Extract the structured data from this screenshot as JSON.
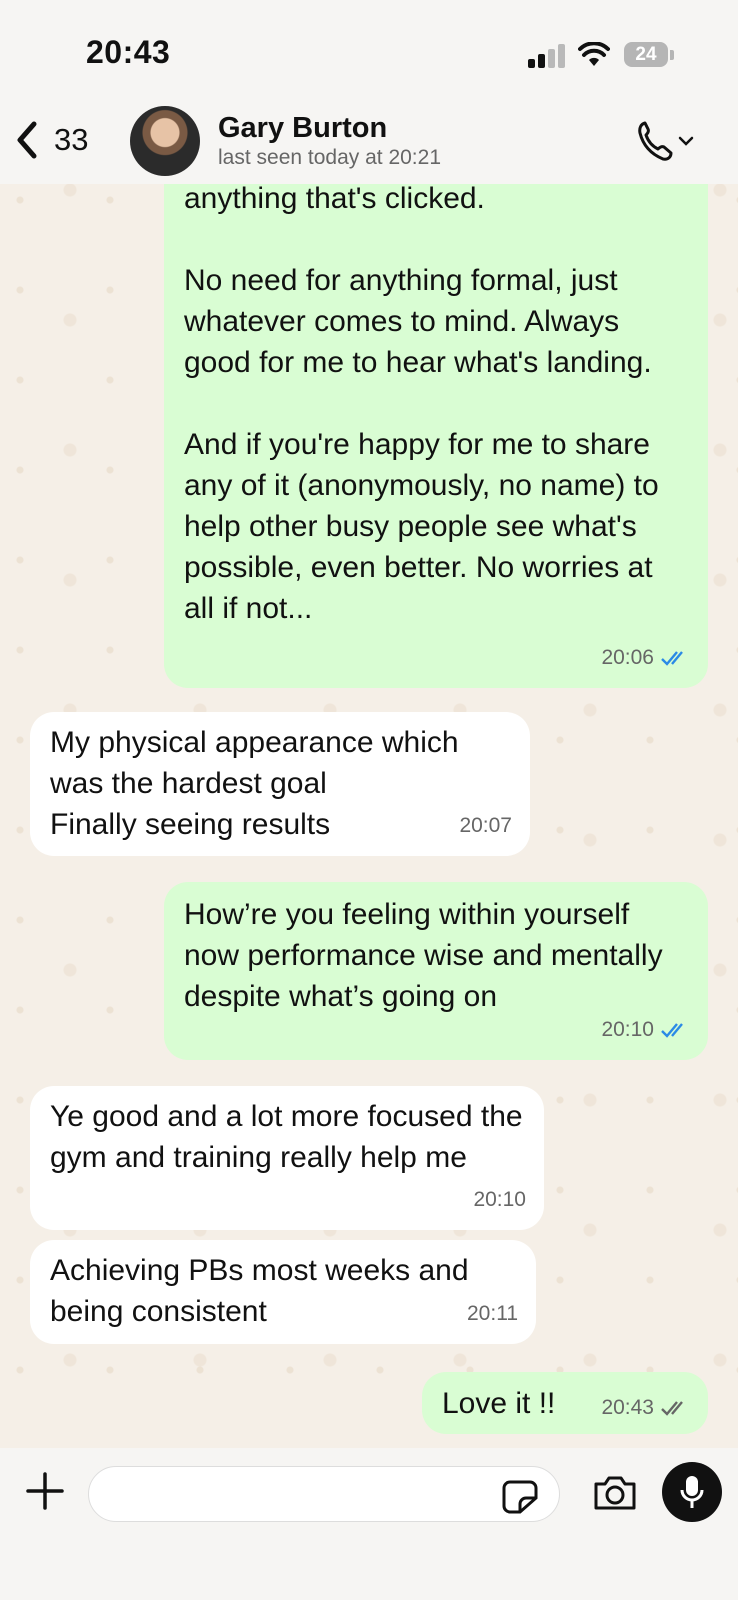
{
  "status_bar": {
    "time": "20:43",
    "battery": "24"
  },
  "header": {
    "back_count": "33",
    "contact_name": "Gary Burton",
    "contact_status": "last seen today at 20:21"
  },
  "messages": [
    {
      "direction": "out",
      "text": "anything that's clicked.\n\nNo need for anything formal, just whatever comes to mind. Always good for me to hear what's landing.\n\nAnd if you're happy for me to share any of it (anonymously, no name) to help other busy people see what's possible, even better. No worries at all if not...",
      "time": "20:06",
      "read": true
    },
    {
      "direction": "in",
      "text": "My physical appearance which was the hardest goal\nFinally seeing results",
      "time": "20:07"
    },
    {
      "direction": "out",
      "text": "How’re you feeling within yourself now performance wise and mentally despite what’s going on",
      "time": "20:10",
      "read": true
    },
    {
      "direction": "in",
      "text": "Ye good and a lot more focused the gym and training really help me",
      "time": "20:10"
    },
    {
      "direction": "in",
      "text": "Achieving PBs most weeks and being consistent",
      "time": "20:11"
    },
    {
      "direction": "out",
      "text": "Love it !!",
      "time": "20:43",
      "read": false
    }
  ],
  "colors": {
    "outgoing_bubble": "#d9fdd3",
    "incoming_bubble": "#ffffff",
    "read_tick": "#2b8ae6",
    "delivered_tick": "#666666"
  },
  "icons": [
    "back-chevron-icon",
    "phone-icon",
    "chevron-down-icon",
    "double-tick-icon",
    "plus-icon",
    "sticker-icon",
    "camera-icon",
    "microphone-icon"
  ]
}
